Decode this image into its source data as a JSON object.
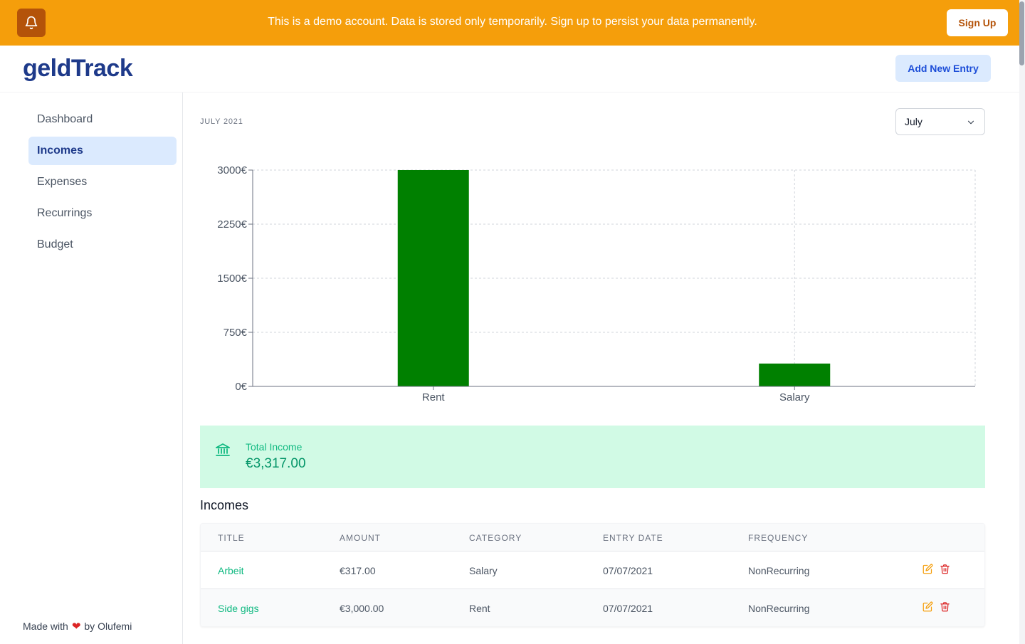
{
  "banner": {
    "message": "This is a demo account. Data is stored only temporarily. Sign up to persist your data permanently.",
    "signup_label": "Sign Up"
  },
  "header": {
    "logo": "geldTrack",
    "add_label": "Add New Entry"
  },
  "sidebar": {
    "items": [
      {
        "label": "Dashboard",
        "active": false
      },
      {
        "label": "Incomes",
        "active": true
      },
      {
        "label": "Expenses",
        "active": false
      },
      {
        "label": "Recurrings",
        "active": false
      },
      {
        "label": "Budget",
        "active": false
      }
    ],
    "footer": {
      "prefix": "Made with",
      "suffix": "by Olufemi"
    }
  },
  "main": {
    "period": "JULY 2021",
    "month_select": "July",
    "total": {
      "label": "Total Income",
      "value": "€3,317.00"
    },
    "section_title": "Incomes",
    "table": {
      "headers": [
        "TITLE",
        "AMOUNT",
        "CATEGORY",
        "ENTRY DATE",
        "FREQUENCY"
      ],
      "rows": [
        {
          "title": "Arbeit",
          "amount": "€317.00",
          "category": "Salary",
          "date": "07/07/2021",
          "frequency": "NonRecurring"
        },
        {
          "title": "Side gigs",
          "amount": "€3,000.00",
          "category": "Rent",
          "date": "07/07/2021",
          "frequency": "NonRecurring"
        }
      ]
    }
  },
  "colors": {
    "banner": "#f59e0b",
    "bar": "#008000",
    "income_green": "#10b981",
    "edit_icon": "#f59e0b",
    "delete_icon": "#dc2626"
  },
  "chart_data": {
    "type": "bar",
    "categories": [
      "Rent",
      "Salary"
    ],
    "values": [
      3000,
      317
    ],
    "ylim": [
      0,
      3000
    ],
    "yticks": [
      0,
      750,
      1500,
      2250,
      3000
    ],
    "ytick_labels": [
      "0€",
      "750€",
      "1500€",
      "2250€",
      "3000€"
    ],
    "grid": true
  }
}
